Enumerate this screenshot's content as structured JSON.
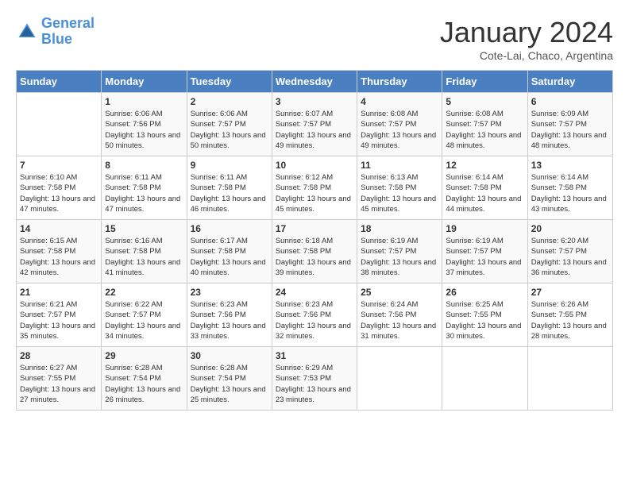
{
  "logo": {
    "line1": "General",
    "line2": "Blue"
  },
  "title": "January 2024",
  "subtitle": "Cote-Lai, Chaco, Argentina",
  "weekdays": [
    "Sunday",
    "Monday",
    "Tuesday",
    "Wednesday",
    "Thursday",
    "Friday",
    "Saturday"
  ],
  "weeks": [
    [
      {
        "day": "",
        "sunrise": "",
        "sunset": "",
        "daylight": ""
      },
      {
        "day": "1",
        "sunrise": "Sunrise: 6:06 AM",
        "sunset": "Sunset: 7:56 PM",
        "daylight": "Daylight: 13 hours and 50 minutes."
      },
      {
        "day": "2",
        "sunrise": "Sunrise: 6:06 AM",
        "sunset": "Sunset: 7:57 PM",
        "daylight": "Daylight: 13 hours and 50 minutes."
      },
      {
        "day": "3",
        "sunrise": "Sunrise: 6:07 AM",
        "sunset": "Sunset: 7:57 PM",
        "daylight": "Daylight: 13 hours and 49 minutes."
      },
      {
        "day": "4",
        "sunrise": "Sunrise: 6:08 AM",
        "sunset": "Sunset: 7:57 PM",
        "daylight": "Daylight: 13 hours and 49 minutes."
      },
      {
        "day": "5",
        "sunrise": "Sunrise: 6:08 AM",
        "sunset": "Sunset: 7:57 PM",
        "daylight": "Daylight: 13 hours and 48 minutes."
      },
      {
        "day": "6",
        "sunrise": "Sunrise: 6:09 AM",
        "sunset": "Sunset: 7:57 PM",
        "daylight": "Daylight: 13 hours and 48 minutes."
      }
    ],
    [
      {
        "day": "7",
        "sunrise": "Sunrise: 6:10 AM",
        "sunset": "Sunset: 7:58 PM",
        "daylight": "Daylight: 13 hours and 47 minutes."
      },
      {
        "day": "8",
        "sunrise": "Sunrise: 6:11 AM",
        "sunset": "Sunset: 7:58 PM",
        "daylight": "Daylight: 13 hours and 47 minutes."
      },
      {
        "day": "9",
        "sunrise": "Sunrise: 6:11 AM",
        "sunset": "Sunset: 7:58 PM",
        "daylight": "Daylight: 13 hours and 46 minutes."
      },
      {
        "day": "10",
        "sunrise": "Sunrise: 6:12 AM",
        "sunset": "Sunset: 7:58 PM",
        "daylight": "Daylight: 13 hours and 45 minutes."
      },
      {
        "day": "11",
        "sunrise": "Sunrise: 6:13 AM",
        "sunset": "Sunset: 7:58 PM",
        "daylight": "Daylight: 13 hours and 45 minutes."
      },
      {
        "day": "12",
        "sunrise": "Sunrise: 6:14 AM",
        "sunset": "Sunset: 7:58 PM",
        "daylight": "Daylight: 13 hours and 44 minutes."
      },
      {
        "day": "13",
        "sunrise": "Sunrise: 6:14 AM",
        "sunset": "Sunset: 7:58 PM",
        "daylight": "Daylight: 13 hours and 43 minutes."
      }
    ],
    [
      {
        "day": "14",
        "sunrise": "Sunrise: 6:15 AM",
        "sunset": "Sunset: 7:58 PM",
        "daylight": "Daylight: 13 hours and 42 minutes."
      },
      {
        "day": "15",
        "sunrise": "Sunrise: 6:16 AM",
        "sunset": "Sunset: 7:58 PM",
        "daylight": "Daylight: 13 hours and 41 minutes."
      },
      {
        "day": "16",
        "sunrise": "Sunrise: 6:17 AM",
        "sunset": "Sunset: 7:58 PM",
        "daylight": "Daylight: 13 hours and 40 minutes."
      },
      {
        "day": "17",
        "sunrise": "Sunrise: 6:18 AM",
        "sunset": "Sunset: 7:58 PM",
        "daylight": "Daylight: 13 hours and 39 minutes."
      },
      {
        "day": "18",
        "sunrise": "Sunrise: 6:19 AM",
        "sunset": "Sunset: 7:57 PM",
        "daylight": "Daylight: 13 hours and 38 minutes."
      },
      {
        "day": "19",
        "sunrise": "Sunrise: 6:19 AM",
        "sunset": "Sunset: 7:57 PM",
        "daylight": "Daylight: 13 hours and 37 minutes."
      },
      {
        "day": "20",
        "sunrise": "Sunrise: 6:20 AM",
        "sunset": "Sunset: 7:57 PM",
        "daylight": "Daylight: 13 hours and 36 minutes."
      }
    ],
    [
      {
        "day": "21",
        "sunrise": "Sunrise: 6:21 AM",
        "sunset": "Sunset: 7:57 PM",
        "daylight": "Daylight: 13 hours and 35 minutes."
      },
      {
        "day": "22",
        "sunrise": "Sunrise: 6:22 AM",
        "sunset": "Sunset: 7:57 PM",
        "daylight": "Daylight: 13 hours and 34 minutes."
      },
      {
        "day": "23",
        "sunrise": "Sunrise: 6:23 AM",
        "sunset": "Sunset: 7:56 PM",
        "daylight": "Daylight: 13 hours and 33 minutes."
      },
      {
        "day": "24",
        "sunrise": "Sunrise: 6:23 AM",
        "sunset": "Sunset: 7:56 PM",
        "daylight": "Daylight: 13 hours and 32 minutes."
      },
      {
        "day": "25",
        "sunrise": "Sunrise: 6:24 AM",
        "sunset": "Sunset: 7:56 PM",
        "daylight": "Daylight: 13 hours and 31 minutes."
      },
      {
        "day": "26",
        "sunrise": "Sunrise: 6:25 AM",
        "sunset": "Sunset: 7:55 PM",
        "daylight": "Daylight: 13 hours and 30 minutes."
      },
      {
        "day": "27",
        "sunrise": "Sunrise: 6:26 AM",
        "sunset": "Sunset: 7:55 PM",
        "daylight": "Daylight: 13 hours and 28 minutes."
      }
    ],
    [
      {
        "day": "28",
        "sunrise": "Sunrise: 6:27 AM",
        "sunset": "Sunset: 7:55 PM",
        "daylight": "Daylight: 13 hours and 27 minutes."
      },
      {
        "day": "29",
        "sunrise": "Sunrise: 6:28 AM",
        "sunset": "Sunset: 7:54 PM",
        "daylight": "Daylight: 13 hours and 26 minutes."
      },
      {
        "day": "30",
        "sunrise": "Sunrise: 6:28 AM",
        "sunset": "Sunset: 7:54 PM",
        "daylight": "Daylight: 13 hours and 25 minutes."
      },
      {
        "day": "31",
        "sunrise": "Sunrise: 6:29 AM",
        "sunset": "Sunset: 7:53 PM",
        "daylight": "Daylight: 13 hours and 23 minutes."
      },
      {
        "day": "",
        "sunrise": "",
        "sunset": "",
        "daylight": ""
      },
      {
        "day": "",
        "sunrise": "",
        "sunset": "",
        "daylight": ""
      },
      {
        "day": "",
        "sunrise": "",
        "sunset": "",
        "daylight": ""
      }
    ]
  ]
}
